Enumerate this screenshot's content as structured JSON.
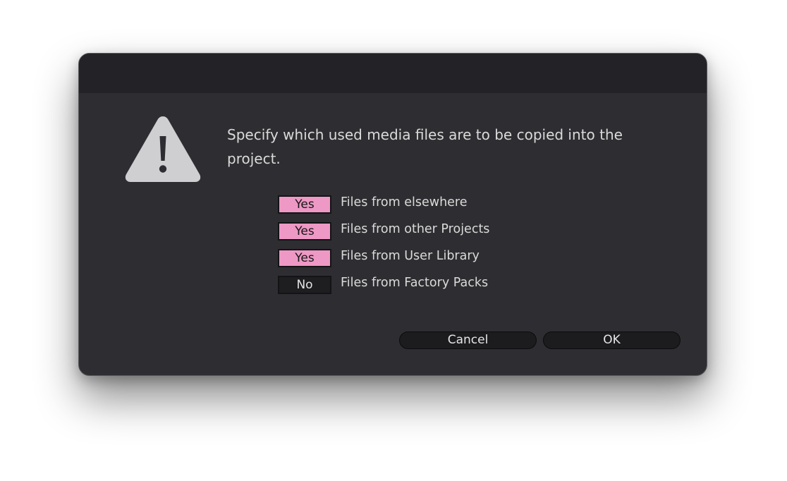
{
  "dialog": {
    "message": "Specify which used media files are to be copied into the project.",
    "icon": "warning-triangle-icon",
    "colors": {
      "background": "#2e2e32",
      "titlebar": "#232327",
      "toggle_on": "#ee98c5",
      "toggle_off": "#1e1e21"
    },
    "options": [
      {
        "value": "Yes",
        "label": "Files from elsewhere"
      },
      {
        "value": "Yes",
        "label": "Files from other Projects"
      },
      {
        "value": "Yes",
        "label": "Files from User Library"
      },
      {
        "value": "No",
        "label": "Files from Factory Packs"
      }
    ],
    "buttons": {
      "cancel": "Cancel",
      "ok": "OK"
    }
  }
}
